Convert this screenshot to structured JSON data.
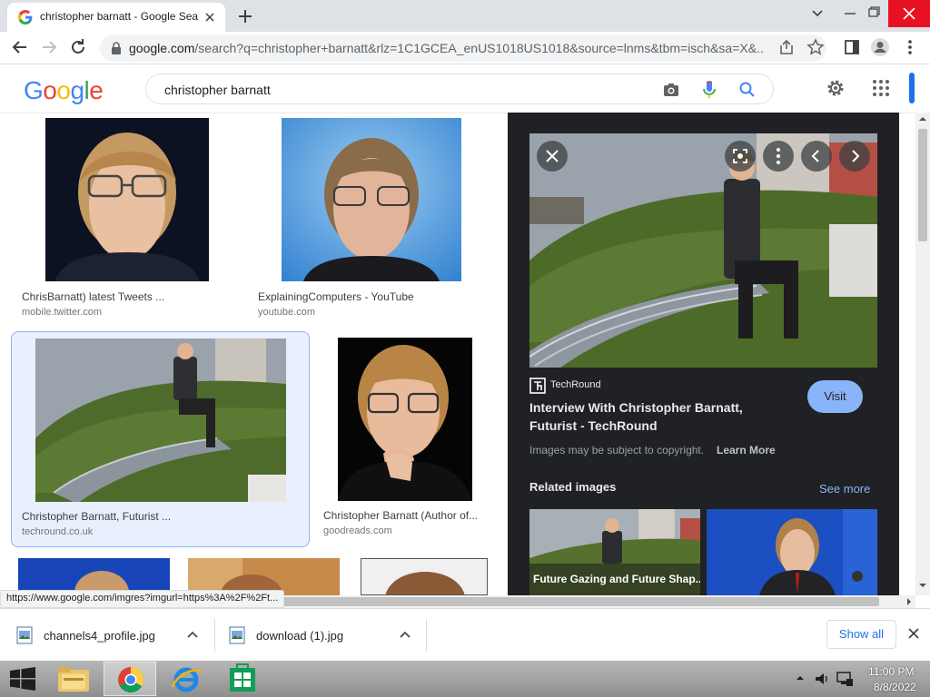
{
  "browser": {
    "tab_title": "christopher barnatt - Google Sea",
    "url_host": "google.com",
    "url_rest": "/search?q=christopher+barnatt&rlz=1C1GCEA_enUS1018US1018&source=lnms&tbm=isch&sa=X&..."
  },
  "google": {
    "logo": [
      "G",
      "o",
      "o",
      "g",
      "l",
      "e"
    ],
    "query": "christopher barnatt"
  },
  "results": [
    {
      "caption": "ChrisBarnatt) latest Tweets ...",
      "source": "mobile.twitter.com"
    },
    {
      "caption": "ExplainingComputers - YouTube",
      "source": "youtube.com"
    },
    {
      "caption": "Christopher Barnatt, Futurist ...",
      "source": "techround.co.uk"
    },
    {
      "caption": "Christopher Barnatt (Author of...",
      "source": "goodreads.com"
    }
  ],
  "panel": {
    "site_name": "TechRound",
    "title_line1": "Interview With Christopher Barnatt,",
    "title_line2": "Futurist - TechRound",
    "visit_label": "Visit",
    "copyright_text": "Images may be subject to copyright.",
    "learn_more": "Learn More",
    "related_heading": "Related images",
    "see_more": "See more",
    "related": [
      {
        "caption": "Future Gazing and Future Shap..."
      }
    ]
  },
  "status_url": "https://www.google.com/imgres?imgurl=https%3A%2F%2Ft...",
  "downloads": {
    "items": [
      {
        "name": "channels4_profile.jpg"
      },
      {
        "name": "download (1).jpg"
      }
    ],
    "show_all": "Show all"
  },
  "taskbar": {
    "time": "11:00 PM",
    "date": "8/8/2022"
  },
  "colors": {
    "google_blue": "#4285f4",
    "google_red": "#ea4335",
    "google_yellow": "#fbbc05",
    "google_green": "#34a853",
    "panel_bg": "#202124",
    "visit_bg": "#8ab4f8"
  }
}
